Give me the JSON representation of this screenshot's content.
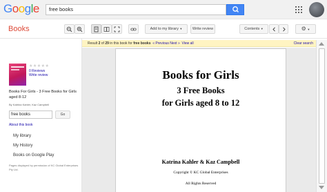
{
  "header": {
    "logo_letters": [
      "G",
      "o",
      "o",
      "g",
      "l",
      "e"
    ],
    "logo_colors": [
      "#4285f4",
      "#ea4335",
      "#fbbc05",
      "#4285f4",
      "#34a853",
      "#ea4335"
    ],
    "search_value": "free books",
    "search_icon": "search-icon",
    "apps_icon": "apps-grid-icon",
    "avatar": "account-avatar"
  },
  "toolbar": {
    "section_title": "Books",
    "add_to_library": "Add to my library",
    "write_review": "Write review",
    "contents": "Contents",
    "icons": [
      "zoom-out-icon",
      "zoom-in-icon",
      "single-page-icon",
      "two-page-icon",
      "fullscreen-icon",
      "link-icon",
      "prev-page-icon",
      "next-page-icon",
      "settings-gear-icon"
    ],
    "accent_color": "#dd4b39"
  },
  "sidebar": {
    "stars": "★★★★★",
    "reviews": "0 Reviews",
    "write_review": "Write review",
    "book_title": "Books For Girls - 3 Free Books for Girls aged 8-12",
    "author": "By Katrina Kahler, Kaz Campbell",
    "search_value": "free books",
    "go": "Go",
    "about": "About this book",
    "nav": [
      "My library",
      "My History",
      "Books on Google Play"
    ],
    "permission": "Pages displayed by permission of KC Global Enterprises Pty Ltd."
  },
  "notice": {
    "text_prefix": "Result",
    "current": "2",
    "middle": "of",
    "total": "29",
    "text_suffix": "in this book for",
    "query": "free books",
    "prev": "« Previous",
    "next": "Next »",
    "view_all": "View all",
    "clear": "Clear search",
    "bg_color": "#fff4c2"
  },
  "page": {
    "title": "Books for Girls",
    "sub1": "3 Free Books",
    "sub2": "for Girls aged 8 to 12",
    "authors": "Katrina Kahler & Kaz Campbell",
    "copyright": "Copyright © KC Global Enterprises",
    "rights": "All Rights Reserved"
  }
}
